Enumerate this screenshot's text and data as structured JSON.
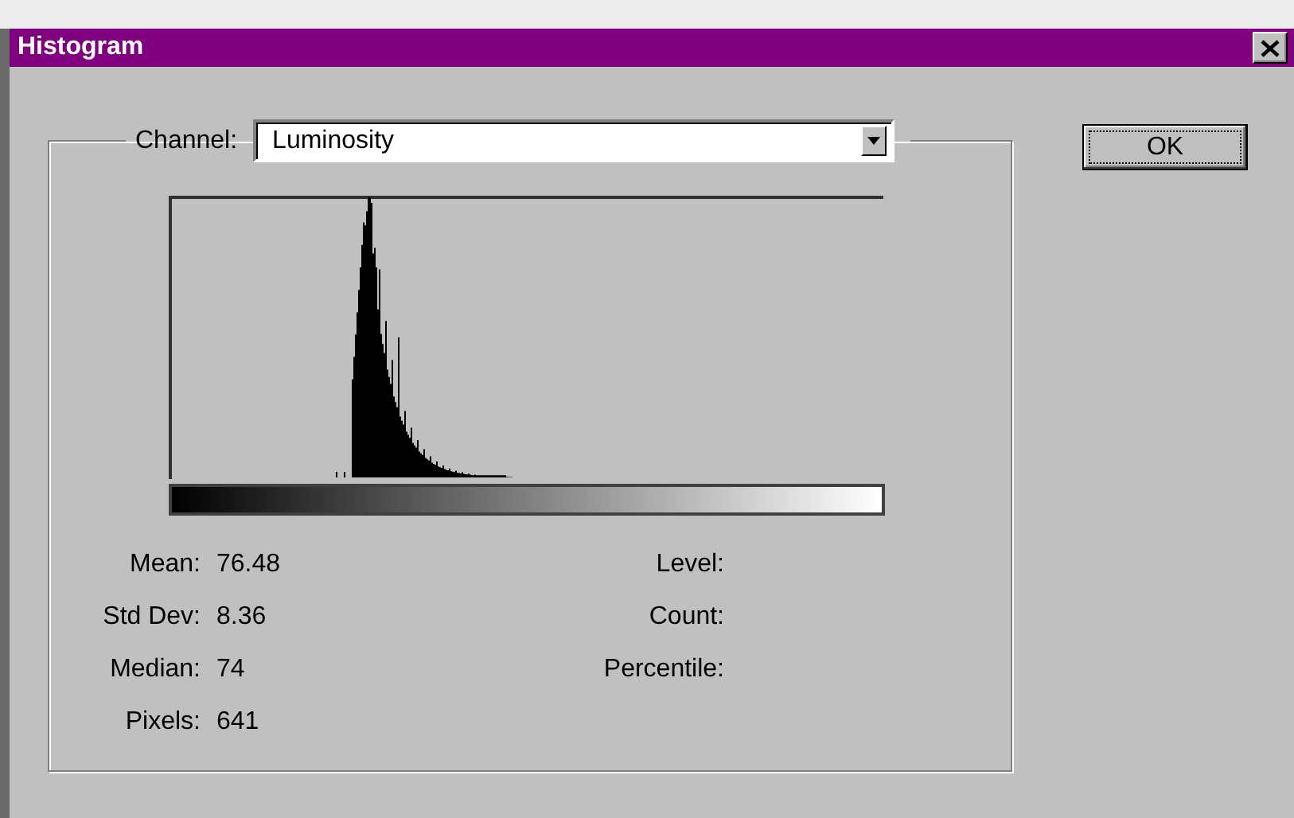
{
  "window": {
    "title": "Histogram"
  },
  "channel": {
    "label": "Channel:",
    "value": "Luminosity"
  },
  "stats_left": [
    {
      "label": "Mean:",
      "value": "76.48"
    },
    {
      "label": "Std Dev:",
      "value": "8.36"
    },
    {
      "label": "Median:",
      "value": "74"
    },
    {
      "label": "Pixels:",
      "value": "641"
    }
  ],
  "stats_right": [
    {
      "label": "Level:"
    },
    {
      "label": "Count:"
    },
    {
      "label": "Percentile:"
    }
  ],
  "buttons": [
    {
      "label": "OK",
      "focused": true
    }
  ]
}
